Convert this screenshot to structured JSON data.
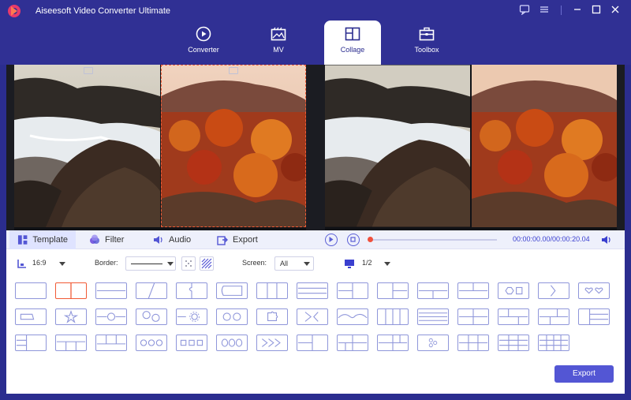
{
  "app": {
    "title": "Aiseesoft Video Converter Ultimate"
  },
  "nav": {
    "tabs": [
      {
        "label": "Converter",
        "icon": "converter-icon"
      },
      {
        "label": "MV",
        "icon": "mv-icon"
      },
      {
        "label": "Collage",
        "icon": "collage-icon",
        "active": true
      },
      {
        "label": "Toolbox",
        "icon": "toolbox-icon"
      }
    ]
  },
  "editor_tabs": [
    {
      "label": "Template",
      "icon": "template-icon",
      "active": true
    },
    {
      "label": "Filter",
      "icon": "filter-icon"
    },
    {
      "label": "Audio",
      "icon": "audio-icon"
    },
    {
      "label": "Export",
      "icon": "export-icon"
    }
  ],
  "player": {
    "time": "00:00:00.00/00:00:20.04"
  },
  "options": {
    "aspect": "16:9",
    "border_label": "Border:",
    "screen_label": "Screen:",
    "screen_value": "All",
    "page": "1/2"
  },
  "export_label": "Export",
  "colors": {
    "accent": "#5356d4",
    "selected": "#f15a35",
    "nav_bg": "#303094"
  }
}
